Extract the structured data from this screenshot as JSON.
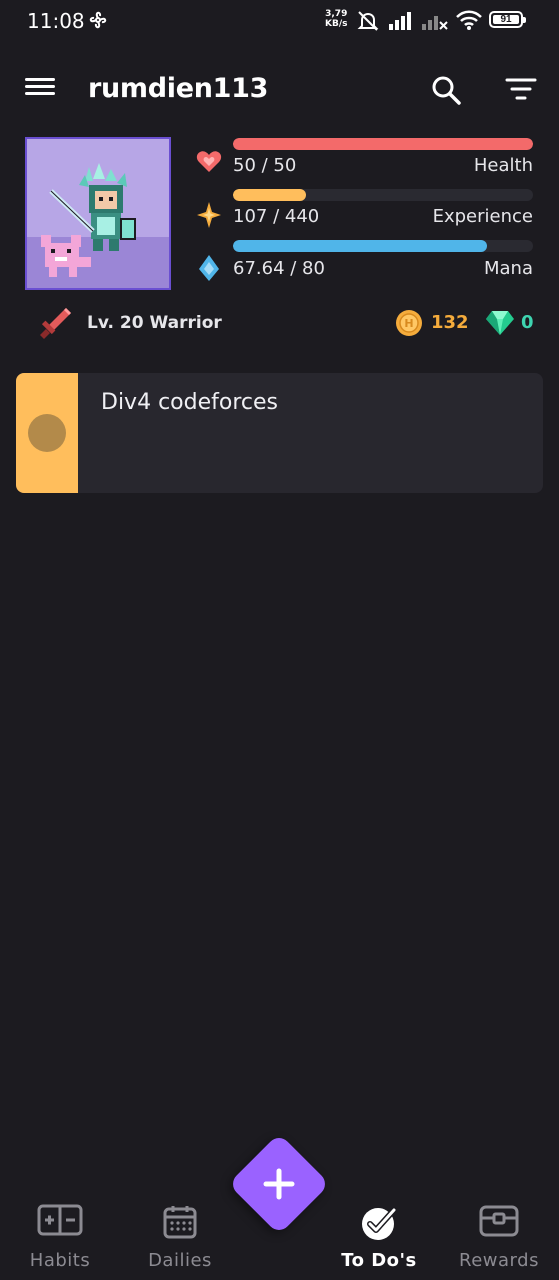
{
  "status_bar": {
    "time": "11:08",
    "net_speed_value": "3,79",
    "net_speed_unit": "KB/s",
    "battery": "91"
  },
  "toolbar": {
    "username": "rumdien113",
    "menu_icon": "hamburger-menu-icon",
    "search_icon": "search-icon",
    "filter_icon": "filter-icon"
  },
  "stats": {
    "health": {
      "value": "50 / 50",
      "label": "Health",
      "fraction": 1.0,
      "color": "#f36a6a"
    },
    "experience": {
      "value": "107 / 440",
      "label": "Experience",
      "fraction": 0.243,
      "color": "#ffbe5c"
    },
    "mana": {
      "value": "67.64 / 80",
      "label": "Mana",
      "fraction": 0.8455,
      "color": "#50b5e9"
    }
  },
  "level": {
    "text": "Lv. 20 Warrior",
    "gold": "132",
    "gems": "0"
  },
  "tasks": [
    {
      "title": "Div4 codeforces",
      "color": "#ffbe5c"
    }
  ],
  "bottom_nav": {
    "items": [
      {
        "label": "Habits",
        "icon": "habits-icon"
      },
      {
        "label": "Dailies",
        "icon": "calendar-icon"
      },
      {
        "label": "To Do's",
        "icon": "check-circle-icon",
        "active": true
      },
      {
        "label": "Rewards",
        "icon": "treasure-chest-icon"
      }
    ],
    "fab_icon": "plus-icon"
  }
}
